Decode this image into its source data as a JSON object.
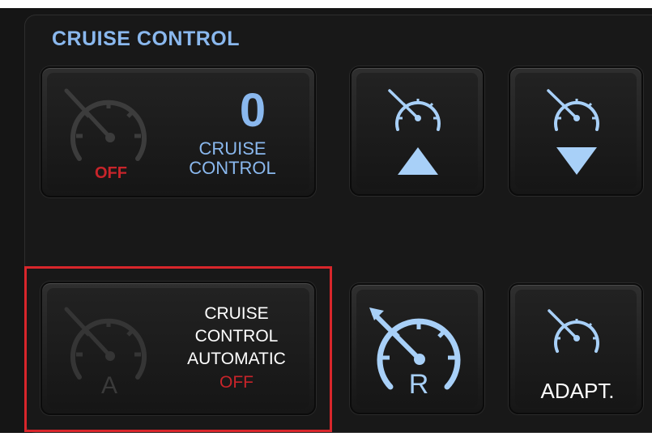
{
  "panel": {
    "title": "CRUISE CONTROL"
  },
  "cruise_control_button": {
    "speed": "0",
    "line1": "CRUISE",
    "line2": "CONTROL",
    "state": "OFF"
  },
  "automatic_button": {
    "line1": "CRUISE",
    "line2": "CONTROL",
    "line3": "AUTOMATIC",
    "state": "OFF",
    "gauge_letter": "A"
  },
  "resume_button": {
    "gauge_letter": "R"
  },
  "adaptive_button": {
    "label": "ADAPT."
  },
  "colors": {
    "accent": "#8ab8ee",
    "off_red": "#c8242a",
    "highlight": "#d8262b"
  },
  "icons": [
    "gauge-icon",
    "speed-up-icon",
    "speed-down-icon",
    "resume-icon",
    "adaptive-icon"
  ]
}
